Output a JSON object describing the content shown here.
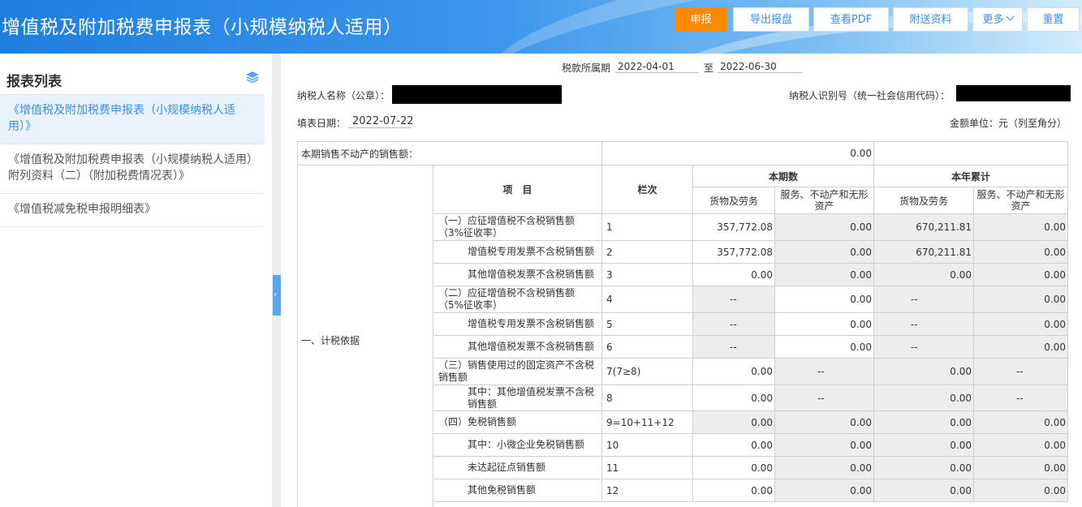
{
  "header": {
    "title": "增值税及附加税费申报表（小规模纳税人适用）",
    "buttons": {
      "declare": "申报",
      "export": "导出报盘",
      "view_pdf": "查看PDF",
      "attach": "附送资料",
      "more": "更多",
      "reset": "重置"
    }
  },
  "sidebar": {
    "title": "报表列表",
    "items": [
      {
        "label": "《增值税及附加税费申报表（小规模纳税人适用）》"
      },
      {
        "label": "《增值税及附加税费申报表（小规模纳税人适用）附列资料（二）（附加税费情况表）》"
      },
      {
        "label": "《增值税减免税申报明细表》"
      }
    ]
  },
  "colors": {
    "primary": "#2d7fdc",
    "declare_button": "#ff8a00",
    "readonly_cell": "#efecec"
  },
  "form": {
    "period_label": "税款所属期",
    "period_start": "2022-04-01",
    "period_to": "至",
    "period_end": "2022-06-30",
    "taxpayer_name_label": "纳税人名称（公章）：",
    "taxpayer_id_label": "纳税人识别号（统一社会信用代码）：",
    "fill_date_label": "填表日期：",
    "fill_date": "2022-07-22",
    "unit_label": "金额单位：元（列至角分）",
    "realestate_label": "本期销售不动产的销售额：",
    "realestate_value": "0.00",
    "section_label": "一、计税依据",
    "headers": {
      "item": "项　目",
      "col": "栏次",
      "current": "本期数",
      "ytd": "本年累计",
      "goods": "货物及劳务",
      "services": "服务、不动产和无形资产"
    },
    "rows": [
      {
        "item": "（一）应征增值税不含税销售额（3%征收率）",
        "col": "1",
        "v1": "357,772.08",
        "v2": "0.00",
        "v3": "670,211.81",
        "v4": "0.00"
      },
      {
        "item": "增值税专用发票不含税销售额",
        "col": "2",
        "v1": "357,772.08",
        "v2": "0.00",
        "v3": "670,211.81",
        "v4": "0.00"
      },
      {
        "item": "其他增值税发票不含税销售额",
        "col": "3",
        "v1": "0.00",
        "v2": "0.00",
        "v3": "0.00",
        "v4": "0.00"
      },
      {
        "item": "（二）应征增值税不含税销售额（5%征收率）",
        "col": "4",
        "v1": "--",
        "v2": "0.00",
        "v3": "--",
        "v4": "0.00"
      },
      {
        "item": "增值税专用发票不含税销售额",
        "col": "5",
        "v1": "--",
        "v2": "0.00",
        "v3": "--",
        "v4": "0.00"
      },
      {
        "item": "其他增值税发票不含税销售额",
        "col": "6",
        "v1": "--",
        "v2": "0.00",
        "v3": "--",
        "v4": "0.00"
      },
      {
        "item": "（三）销售使用过的固定资产不含税销售额",
        "col": "7(7≥8)",
        "v1": "0.00",
        "v2": "--",
        "v3": "0.00",
        "v4": "--"
      },
      {
        "item": "其中：其他增值税发票不含税销售额",
        "col": "8",
        "v1": "0.00",
        "v2": "--",
        "v3": "0.00",
        "v4": "--"
      },
      {
        "item": "（四）免税销售额",
        "col": "9=10+11+12",
        "v1": "0.00",
        "v2": "0.00",
        "v3": "0.00",
        "v4": "0.00"
      },
      {
        "item": "其中：小微企业免税销售额",
        "col": "10",
        "v1": "0.00",
        "v2": "0.00",
        "v3": "0.00",
        "v4": "0.00"
      },
      {
        "item": "未达起征点销售额",
        "col": "11",
        "v1": "0.00",
        "v2": "0.00",
        "v3": "0.00",
        "v4": "0.00"
      },
      {
        "item": "其他免税销售额",
        "col": "12",
        "v1": "0.00",
        "v2": "0.00",
        "v3": "0.00",
        "v4": "0.00"
      }
    ]
  }
}
